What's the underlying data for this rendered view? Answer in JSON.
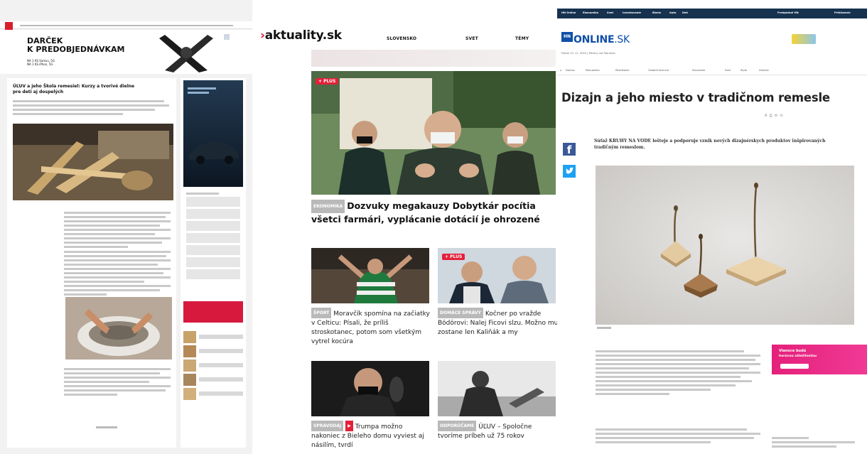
{
  "panel1": {
    "ad": {
      "title_line1": "DARČEK",
      "title_line2": "K PREDOBJEDNÁVKAM",
      "sub_line1": "NA 1 KS Samsu, 5G",
      "sub_line2": "NA 1 KS iPhon, 5G"
    },
    "article": {
      "headline_line1": "ÚĽUV a jeho Škola remesiel: Kurzy a tvorivé dielne",
      "headline_line2": "pre deti aj dospelých"
    }
  },
  "panel2": {
    "brand": "aktuality.sk",
    "nav": [
      "SLOVENSKO",
      "SVET",
      "TÉMY"
    ],
    "plus_label": "+ PLUS",
    "main": {
      "tag": "EKONOMIKA",
      "headline": "Dozvuky megakauzy Dobytkár pocítia všetci farmári, vyplácanie dotácií je ohrozené"
    },
    "cards": [
      {
        "tag": "ŠPORT",
        "headline": "Moravčík spomína na začiatky v Celticu: Písali, že príliš stroskotanec, potom som všetkým vytrel kocúra"
      },
      {
        "tag": "DOMÁCE SPRÁVY",
        "headline": "Kočner po vražde Bödörovi: Nalej Ficovi slzu. Možno mu zostane len Kaliňák a my"
      },
      {
        "tag": "SPRAVODAJ",
        "headline": "Trumpa možno nakoniec z Bieleho domu vyviest aj násilím, tvrdí"
      },
      {
        "tag": "ODPORÚČAME",
        "headline": "ÚĽUV – Spoločne tvoríme príbeh už 75 rokov"
      }
    ]
  },
  "panel3": {
    "topnav": [
      "HN Online",
      "Ekonomika",
      "Svet",
      "Investovanie",
      "Biznis",
      "Auto",
      "Deň"
    ],
    "topnav_right": [
      "Predplatné HN",
      "Prihlásenie"
    ],
    "logo_hn": "HN",
    "logo_text": "ONLINE",
    "logo_suffix": ".SK",
    "date": "Piatok 13. 11. 2020 | Meniny má Stanislav",
    "secnav": [
      "Domov",
      "Ekonomika",
      "Podnikanie",
      "Osobné financie",
      "Slovensko",
      "Svet",
      "Style",
      "Zdravie"
    ],
    "title": "Dizajn a jeho miesto v tradičnom remesle",
    "lead": "Súťaž KRUHY NA VODE lešteje a podporuje vznik nových dizajnérskych produktov inšpirovaných tradičným remeslom.",
    "pink_ad_line1": "Vianoce budú",
    "pink_ad_line2": "horúcou záležitosťou"
  },
  "colors": {
    "red": "#e4203a",
    "hn_blue": "#0f4fa8",
    "hn_navy": "#16324f",
    "facebook": "#3b5998",
    "twitter": "#1da1f2",
    "pink": "#e4207a"
  }
}
